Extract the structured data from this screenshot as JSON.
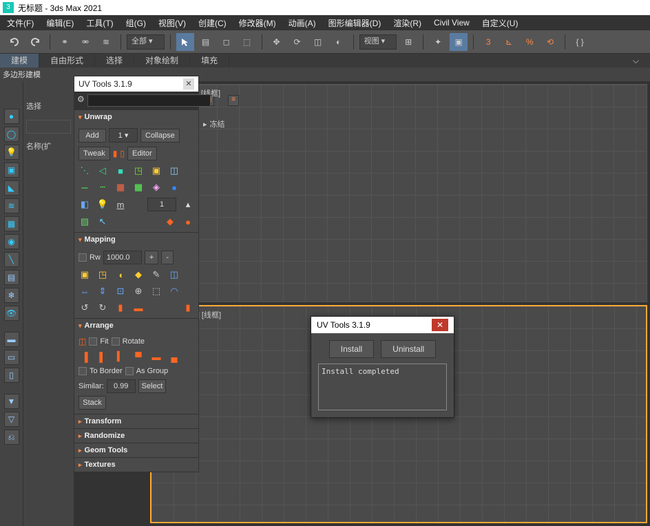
{
  "title": "无标题 - 3ds Max 2021",
  "menus": [
    "文件(F)",
    "编辑(E)",
    "工具(T)",
    "组(G)",
    "视图(V)",
    "创建(C)",
    "修改器(M)",
    "动画(A)",
    "图形编辑器(D)",
    "渲染(R)",
    "Civil View",
    "自定义(U)"
  ],
  "toolbar": {
    "all_combo": "全部",
    "view_combo": "视图"
  },
  "ribbon": {
    "tabs": [
      "建模",
      "自由形式",
      "选择",
      "对象绘制",
      "填充"
    ],
    "sub": "多边形建模"
  },
  "scene": {
    "select_label": "选择",
    "name_label": "名称(扩"
  },
  "frozen": {
    "arrow": "▸",
    "label": "冻结"
  },
  "uvpanel": {
    "title": "UV Tools 3.1.9",
    "sections": {
      "unwrap": {
        "title": "Unwrap",
        "add": "Add",
        "one": "1",
        "collapse": "Collapse",
        "tweak": "Tweak",
        "editor": "Editor",
        "row3_num": "1"
      },
      "mapping": {
        "title": "Mapping",
        "rw": "Rw",
        "rw_val": "1000.0",
        "plus": "+",
        "minus": "-"
      },
      "arrange": {
        "title": "Arrange",
        "fit": "Fit",
        "rotate": "Rotate",
        "to_border": "To Border",
        "as_group": "As Group",
        "similar": "Similar:",
        "similar_val": "0.99",
        "select": "Select",
        "stack": "Stack"
      },
      "transform": "Transform",
      "randomize": "Randomize",
      "geom": "Geom Tools",
      "textures": "Textures"
    }
  },
  "viewports": {
    "top": "[+] [顶] [标准] [线框]",
    "left": "[+] [左] [标准] [线框]"
  },
  "dialog": {
    "title": "UV Tools 3.1.9",
    "install": "Install",
    "uninstall": "Uninstall",
    "log": "Install completed"
  }
}
